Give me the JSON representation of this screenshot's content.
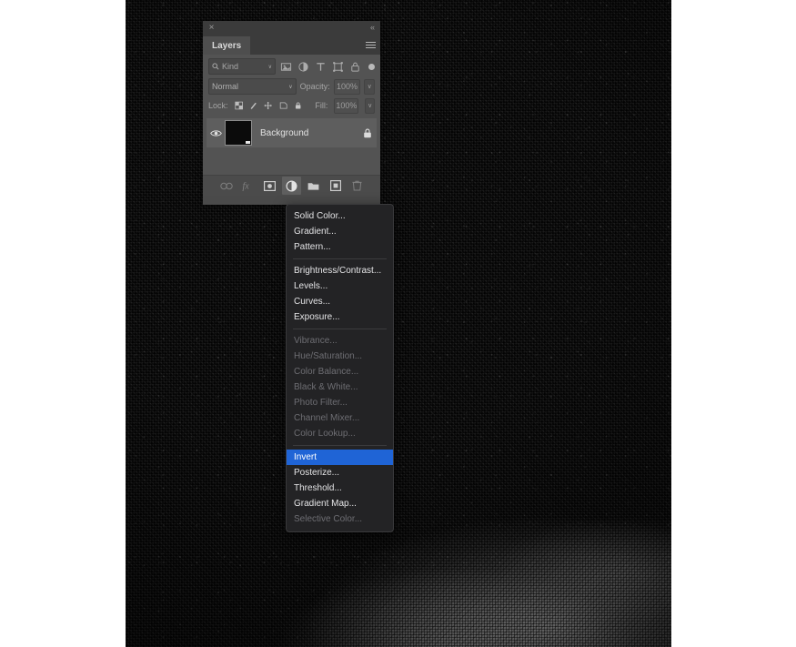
{
  "canvas": {
    "name": "photoshop-document-canvas",
    "background_color": "#0a0a0a",
    "description": "dark grunge halftone texture with bright worn wash at lower right"
  },
  "panel": {
    "title": "Layers",
    "close_label": "×",
    "collapse_label": "«",
    "menu_label": "panel-menu",
    "filter": {
      "kind_label": "Kind",
      "search_icon": "search-icon",
      "chevron": "∨",
      "icons": [
        {
          "name": "filter-pixel-icon",
          "glyph": "image"
        },
        {
          "name": "filter-adjustment-icon",
          "glyph": "adjustment"
        },
        {
          "name": "filter-type-icon",
          "glyph": "T"
        },
        {
          "name": "filter-shape-icon",
          "glyph": "shape"
        },
        {
          "name": "filter-smart-object-icon",
          "glyph": "lock"
        }
      ],
      "toggle_name": "filter-enable-toggle"
    },
    "blend": {
      "mode": "Normal",
      "mode_chevron": "∨",
      "opacity_label": "Opacity:",
      "opacity_value": "100%",
      "opacity_chevron": "∨"
    },
    "lock": {
      "label": "Lock:",
      "fill_label": "Fill:",
      "fill_value": "100%",
      "fill_chevron": "∨",
      "icons": [
        {
          "name": "lock-transparent-pixels-icon"
        },
        {
          "name": "lock-image-pixels-icon"
        },
        {
          "name": "lock-position-icon"
        },
        {
          "name": "lock-artboard-nesting-icon"
        },
        {
          "name": "lock-all-icon"
        }
      ]
    },
    "layers": [
      {
        "name": "Background",
        "visible": true,
        "locked": true,
        "thumbnail": "black"
      }
    ],
    "footer_buttons": [
      {
        "name": "link-layers-button",
        "glyph": "link",
        "active": false,
        "dim": true
      },
      {
        "name": "layer-style-button",
        "glyph": "fx",
        "active": false,
        "dim": true
      },
      {
        "name": "add-layer-mask-button",
        "glyph": "mask",
        "active": false,
        "dim": false
      },
      {
        "name": "new-adjustment-layer-button",
        "glyph": "adjustment",
        "active": true,
        "dim": false
      },
      {
        "name": "new-group-button",
        "glyph": "folder",
        "active": false,
        "dim": false
      },
      {
        "name": "new-layer-button",
        "glyph": "new-layer",
        "active": false,
        "dim": false
      },
      {
        "name": "delete-layer-button",
        "glyph": "trash",
        "active": false,
        "dim": true
      }
    ]
  },
  "adjustment_menu": {
    "selected": "Invert",
    "highlight_color": "#1f64d6",
    "groups": [
      {
        "items": [
          {
            "label": "Solid Color...",
            "enabled": true,
            "selected": false
          },
          {
            "label": "Gradient...",
            "enabled": true,
            "selected": false
          },
          {
            "label": "Pattern...",
            "enabled": true,
            "selected": false
          }
        ]
      },
      {
        "items": [
          {
            "label": "Brightness/Contrast...",
            "enabled": true,
            "selected": false
          },
          {
            "label": "Levels...",
            "enabled": true,
            "selected": false
          },
          {
            "label": "Curves...",
            "enabled": true,
            "selected": false
          },
          {
            "label": "Exposure...",
            "enabled": true,
            "selected": false
          }
        ]
      },
      {
        "items": [
          {
            "label": "Vibrance...",
            "enabled": false,
            "selected": false
          },
          {
            "label": "Hue/Saturation...",
            "enabled": false,
            "selected": false
          },
          {
            "label": "Color Balance...",
            "enabled": false,
            "selected": false
          },
          {
            "label": "Black & White...",
            "enabled": false,
            "selected": false
          },
          {
            "label": "Photo Filter...",
            "enabled": false,
            "selected": false
          },
          {
            "label": "Channel Mixer...",
            "enabled": false,
            "selected": false
          },
          {
            "label": "Color Lookup...",
            "enabled": false,
            "selected": false
          }
        ]
      },
      {
        "items": [
          {
            "label": "Invert",
            "enabled": true,
            "selected": true
          },
          {
            "label": "Posterize...",
            "enabled": true,
            "selected": false
          },
          {
            "label": "Threshold...",
            "enabled": true,
            "selected": false
          },
          {
            "label": "Gradient Map...",
            "enabled": true,
            "selected": false
          },
          {
            "label": "Selective Color...",
            "enabled": false,
            "selected": false
          }
        ]
      }
    ]
  }
}
